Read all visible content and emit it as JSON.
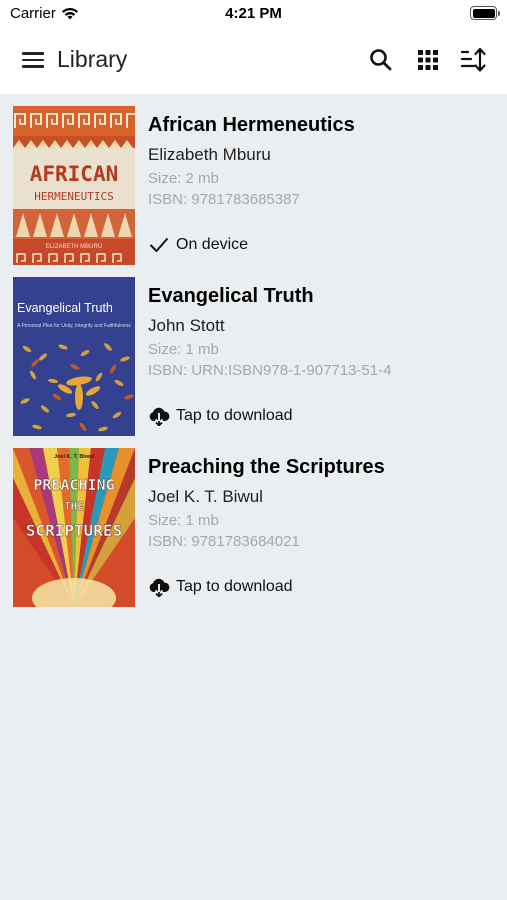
{
  "status_bar": {
    "carrier": "Carrier",
    "time": "4:21 PM"
  },
  "app_bar": {
    "title": "Library"
  },
  "books": [
    {
      "title": "African Hermeneutics",
      "author": "Elizabeth Mburu",
      "size": "Size: 2 mb",
      "isbn": "ISBN: 9781783685387",
      "status": "On device",
      "cover": {
        "line1": "AFRICAN",
        "line2": "HERMENEUTICS",
        "byline": "ELIZABETH MBURU"
      }
    },
    {
      "title": "Evangelical Truth",
      "author": "John Stott",
      "size": "Size: 1 mb",
      "isbn": "ISBN: URN:ISBN978-1-907713-51-4",
      "status": "Tap to download",
      "cover": {
        "line1": "Evangelical Truth",
        "line2": "A Personal Plea for Unity, Integrity and Faithfulness"
      }
    },
    {
      "title": "Preaching the Scriptures",
      "author": "Joel K. T. Biwul",
      "size": "Size: 1 mb",
      "isbn": "ISBN: 9781783684021",
      "status": "Tap to download",
      "cover": {
        "author": "Joel K. T. Biwul",
        "line1": "PREACHING",
        "line2": "THE",
        "line3": "SCRIPTURES"
      }
    }
  ],
  "colors": {
    "background": "#ebeef1",
    "secondary_text": "#a5a8ab",
    "cover1_bg": "#e9e0cf",
    "cover1_title": "#b23a1e",
    "cover2_bg": "#33418e",
    "cover3_bg": "#d44b2a"
  }
}
